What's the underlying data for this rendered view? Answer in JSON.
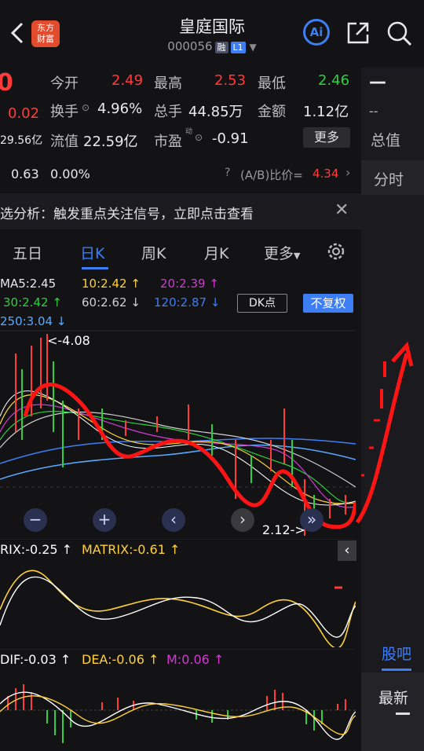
{
  "header": {
    "logo_line1": "东方",
    "logo_line2": "财富",
    "title": "皇庭国际",
    "code": "000056",
    "tag_rong": "融",
    "tag_l1": "L1",
    "ai_label": "Ai"
  },
  "quote": {
    "price_partial": "0",
    "change": "0.02",
    "market_cap_partial": "29.56亿",
    "pct_partial": "0.63",
    "pct_change": "0.00%",
    "open_label": "今开",
    "open": "2.49",
    "high_label": "最高",
    "high": "2.53",
    "low_label": "最低",
    "low": "2.46",
    "turnover_label": "换手",
    "turnover": "4.96%",
    "volume_label": "总手",
    "volume": "44.85万",
    "amount_label": "金额",
    "amount": "1.12亿",
    "float_cap_label": "流值",
    "float_cap": "22.59亿",
    "pe_label": "市盈",
    "pe_sup": "动",
    "pe": "-0.91",
    "more_button": "更多",
    "ab_ratio_label": "(A/B)比价=",
    "ab_ratio": "4.34"
  },
  "right_panel": {
    "dash1": "—",
    "dash2": "--",
    "total_label": "总值",
    "timeshare_label": "分时",
    "guba_tab": "股吧",
    "latest_tab": "最新"
  },
  "banner": {
    "text": "选分析：触发重点关注信号，立即点击查看"
  },
  "period_tabs": {
    "five_day": "五日",
    "daily": "日K",
    "weekly": "周K",
    "monthly": "月K",
    "more": "更多"
  },
  "ma_legend": {
    "ma5": "MA5:2.45",
    "ma10": "10:2.42",
    "ma20": "20:2.39",
    "ma30": "30:2.42",
    "ma60": "60:2.62",
    "ma120": "120:2.87",
    "ma250": "250:3.04",
    "dk_button": "DK点",
    "fq_button": "不复权"
  },
  "chart": {
    "high_marker": "<-4.08",
    "low_marker": "2.12->"
  },
  "matrix": {
    "trix": "RIX:-0.25",
    "matrix": "MATRIX:-0.61"
  },
  "macd": {
    "dif": "DIF:-0.03",
    "dea": "DEA:-0.06",
    "m": "M:0.06"
  },
  "colors": {
    "up": "#ff3b3b",
    "down": "#2fcf3f",
    "accent": "#3d7ef5",
    "yellow": "#ffd23a",
    "magenta": "#d23ad2"
  }
}
